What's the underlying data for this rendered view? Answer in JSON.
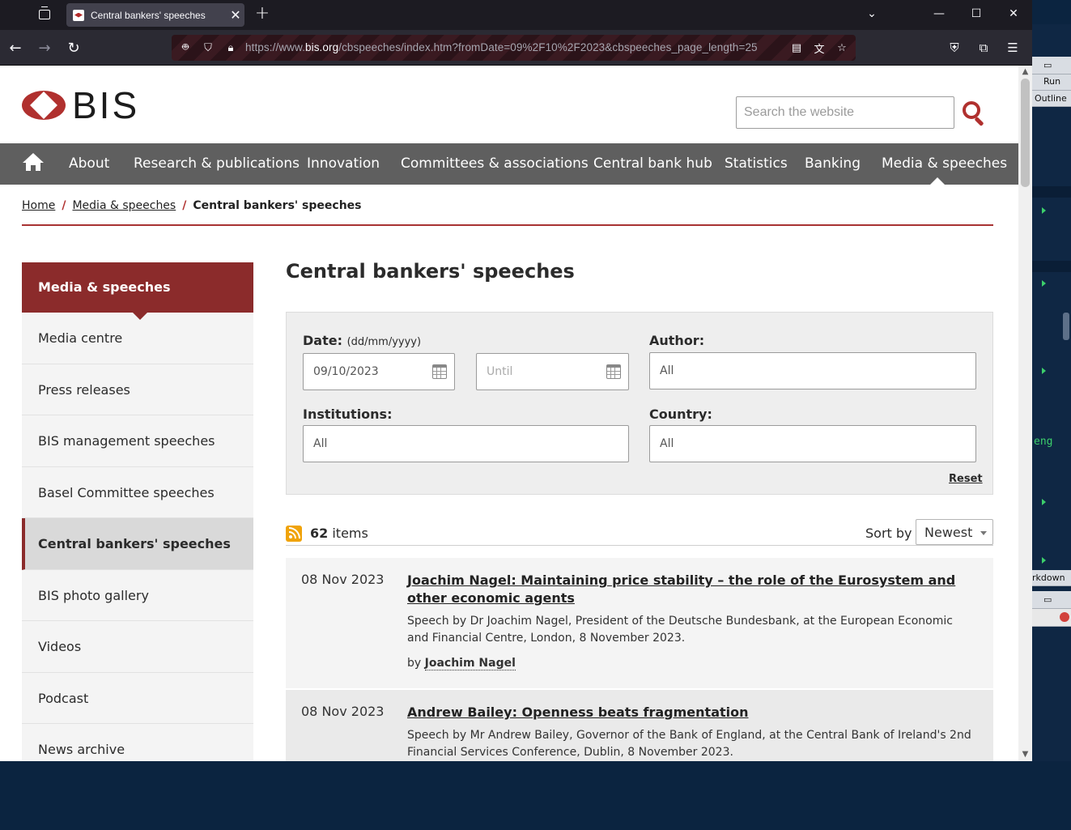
{
  "browser": {
    "tab_title": "Central bankers' speeches",
    "url_prefix": "https://www.",
    "url_host": "bis.org",
    "url_rest": "/cbspeeches/index.htm?fromDate=09%2F10%2F2023&cbspeeches_page_length=25"
  },
  "site": {
    "logo_text": "BIS",
    "search_placeholder": "Search the website"
  },
  "nav": {
    "items": [
      "About",
      "Research & publications",
      "Innovation",
      "Committees & associations",
      "Central bank hub",
      "Statistics",
      "Banking",
      "Media & speeches"
    ]
  },
  "breadcrumb": {
    "home": "Home",
    "section": "Media & speeches",
    "current": "Central bankers' speeches"
  },
  "sidebar": {
    "heading": "Media & speeches",
    "items": [
      "Media centre",
      "Press releases",
      "BIS management speeches",
      "Basel Committee speeches",
      "Central bankers' speeches",
      "BIS photo gallery",
      "Videos",
      "Podcast",
      "News archive"
    ],
    "active_index": 4
  },
  "main": {
    "title": "Central bankers' speeches"
  },
  "filters": {
    "date_label": "Date:",
    "date_hint": "(dd/mm/yyyy)",
    "from_value": "09/10/2023",
    "until_placeholder": "Until",
    "author_label": "Author:",
    "author_value": "All",
    "institutions_label": "Institutions:",
    "institutions_value": "All",
    "country_label": "Country:",
    "country_value": "All",
    "reset_label": "Reset"
  },
  "results": {
    "count": "62",
    "count_suffix": "items",
    "sort_label": "Sort by",
    "sort_value": "Newest",
    "items": [
      {
        "date": "08 Nov 2023",
        "title": "Joachim Nagel: Maintaining price stability – the role of the Eurosystem and other economic agents",
        "description": "Speech by Dr Joachim Nagel, President of the Deutsche Bundesbank, at the European Economic and Financial Centre, London, 8 November 2023.",
        "by_prefix": "by",
        "author": "Joachim Nagel"
      },
      {
        "date": "08 Nov 2023",
        "title": "Andrew Bailey: Openness beats fragmentation",
        "description": "Speech by Mr Andrew Bailey, Governor of the Bank of England, at the Central Bank of Ireland's 2nd Financial Services Conference, Dublin, 8 November 2023."
      }
    ]
  },
  "desktop": {
    "run_label": "Run",
    "outline_label": "Outline",
    "eng_text": "eng",
    "markdown_label": "rkdown"
  },
  "colors": {
    "brand_red": "#b0302e",
    "nav_gray": "#5f5f5f",
    "sidebar_head": "#8b2b2b"
  }
}
